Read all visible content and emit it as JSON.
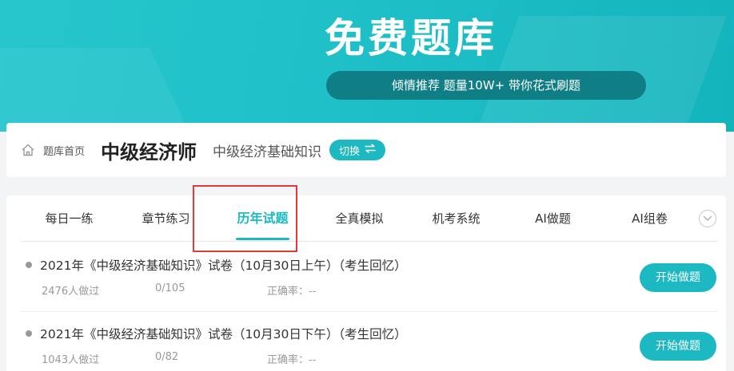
{
  "banner": {
    "title": "免费题库",
    "slogan": "倾情推荐 题量10W+ 带你花式刷题"
  },
  "breadcrumb": {
    "home_icon": "home-icon",
    "home_label": "题库首页",
    "exam": "中级经济师",
    "subject": "中级经济基础知识",
    "switch_label": "切换",
    "switch_icon": "swap-arrows-icon"
  },
  "tabs": [
    {
      "label": "每日一练",
      "active": false
    },
    {
      "label": "章节练习",
      "active": false
    },
    {
      "label": "历年试题",
      "active": true
    },
    {
      "label": "全真模拟",
      "active": false
    },
    {
      "label": "机考系统",
      "active": false
    },
    {
      "label": "AI做题",
      "active": false
    },
    {
      "label": "AI组卷",
      "active": false
    }
  ],
  "papers": [
    {
      "title": "2021年《中级经济基础知识》试卷（10月30日上午）（考生回忆）",
      "done_count": "2476人做过",
      "progress": "0/105",
      "accuracy": "正确率：--",
      "button": "开始做题"
    },
    {
      "title": "2021年《中级经济基础知识》试卷（10月30日下午）（考生回忆）",
      "done_count": "1043人做过",
      "progress": "0/82",
      "accuracy": "正确率：--",
      "button": "开始做题"
    }
  ],
  "colors": {
    "accent": "#1cb9c2",
    "slogan_bg": "#0f7f85",
    "highlight": "#e03a3a"
  }
}
